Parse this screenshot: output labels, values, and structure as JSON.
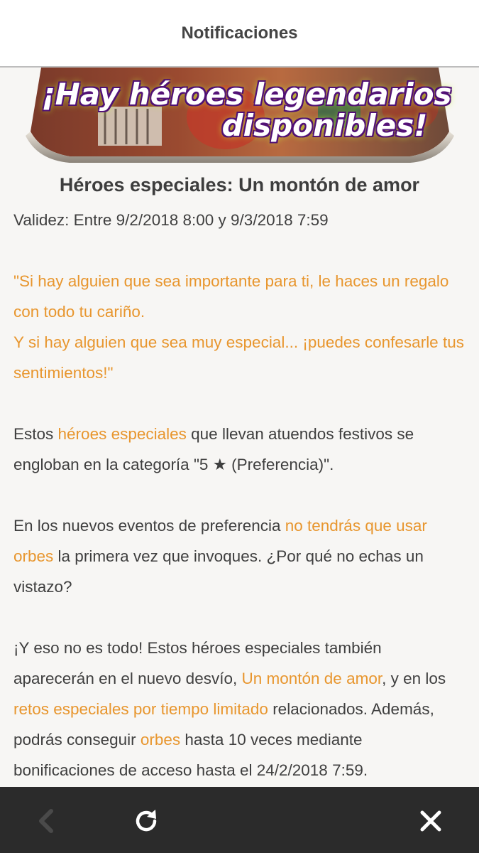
{
  "header": {
    "title": "Notificaciones"
  },
  "banner": {
    "line1": "¡Hay héroes legendarios",
    "line2": "disponibles!"
  },
  "article": {
    "title": "Héroes especiales: Un montón de amor",
    "validity": "Validez: Entre 9/2/2018 8:00 y 9/3/2018 7:59",
    "quote_line1": "\"Si hay alguien que sea importante para ti, le haces un regalo con todo tu cariño.",
    "quote_line2": "Y si hay alguien que sea muy especial... ¡puedes confesarle tus sentimientos!\"",
    "p1_a": "Estos ",
    "p1_link": "héroes especiales",
    "p1_b": " que llevan atuendos festivos se engloban en la categoría \"5 ★ (Preferencia)\".",
    "p2_a": "En los nuevos eventos de preferencia ",
    "p2_link": "no tendrás que usar orbes",
    "p2_b": " la primera vez que invoques. ¿Por qué no echas un vistazo?",
    "p3_a": "¡Y eso no es todo! Estos héroes especiales también aparecerán en el nuevo desvío, ",
    "p3_link1": "Un montón de amor",
    "p3_b": ", y en los ",
    "p3_link2": "retos especiales por tiempo limitado",
    "p3_c": " relacionados. Además, podrás conseguir ",
    "p3_link3": "orbes",
    "p3_d": " hasta 10 veces mediante bonificaciones de acceso hasta el 24/2/2018 7:59."
  },
  "bottom_bar": {
    "back_icon": "chevron-left-icon",
    "refresh_icon": "refresh-icon",
    "close_icon": "close-icon"
  },
  "colors": {
    "accent_orange": "#e8962e",
    "text": "#3f3f3f",
    "bar": "#2b2b2b"
  }
}
